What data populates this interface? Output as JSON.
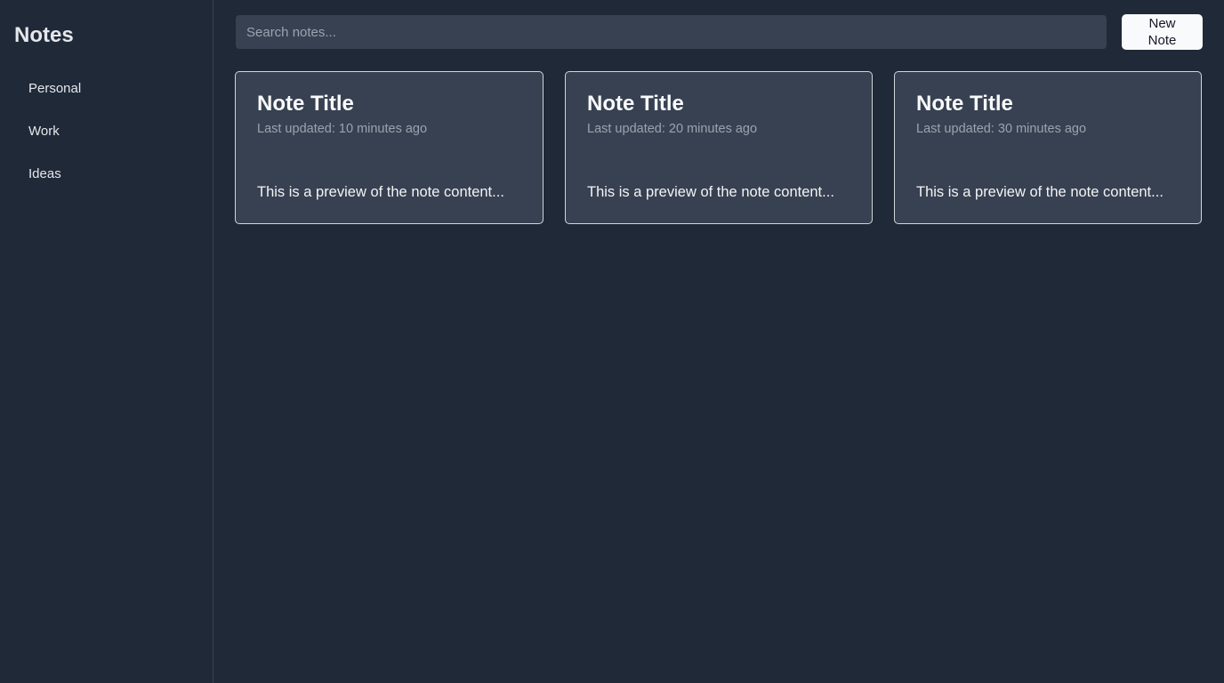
{
  "sidebar": {
    "title": "Notes",
    "items": [
      {
        "label": "Personal"
      },
      {
        "label": "Work"
      },
      {
        "label": "Ideas"
      }
    ]
  },
  "toolbar": {
    "search_placeholder": "Search notes...",
    "new_note_label": "New Note"
  },
  "notes": [
    {
      "title": "Note Title",
      "updated": "Last updated: 10 minutes ago",
      "preview": "This is a preview of the note content..."
    },
    {
      "title": "Note Title",
      "updated": "Last updated: 20 minutes ago",
      "preview": "This is a preview of the note content..."
    },
    {
      "title": "Note Title",
      "updated": "Last updated: 30 minutes ago",
      "preview": "This is a preview of the note content..."
    }
  ],
  "colors": {
    "background": "#1f2937",
    "sidebar_bg": "#202938",
    "card_bg": "#374151",
    "card_border": "#d1d5db",
    "button_bg": "#f9fafb",
    "muted_text": "#9ca3af"
  }
}
